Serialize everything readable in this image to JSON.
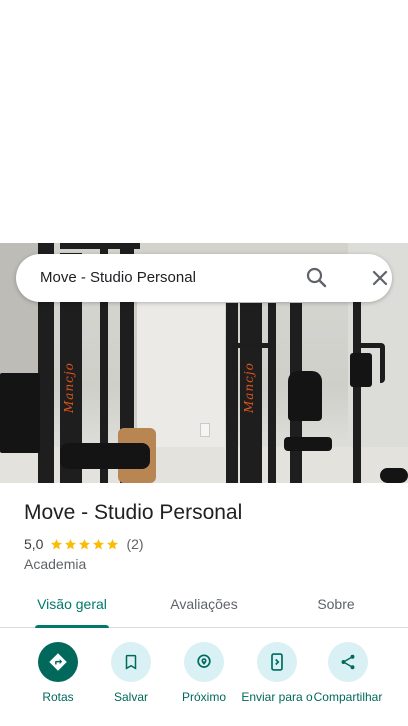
{
  "search": {
    "value": "Move - Studio Personal"
  },
  "photo": {
    "brand_text": "Mancjo"
  },
  "place": {
    "title": "Move - Studio Personal",
    "rating": "5,0",
    "stars": 5,
    "review_count": "(2)",
    "category": "Academia"
  },
  "tabs": [
    {
      "label": "Visão geral",
      "active": true
    },
    {
      "label": "Avaliações",
      "active": false
    },
    {
      "label": "Sobre",
      "active": false
    }
  ],
  "actions": [
    {
      "label": "Rotas",
      "icon": "directions-icon"
    },
    {
      "label": "Salvar",
      "icon": "bookmark-icon"
    },
    {
      "label": "Próximo",
      "icon": "nearby-icon"
    },
    {
      "label": "Enviar para o",
      "icon": "send-to-phone-icon"
    },
    {
      "label": "Compartilhar",
      "icon": "share-icon"
    }
  ],
  "colors": {
    "accent": "#00796b",
    "action_bg": "#d9f0f4",
    "star": "#fbbc04"
  }
}
